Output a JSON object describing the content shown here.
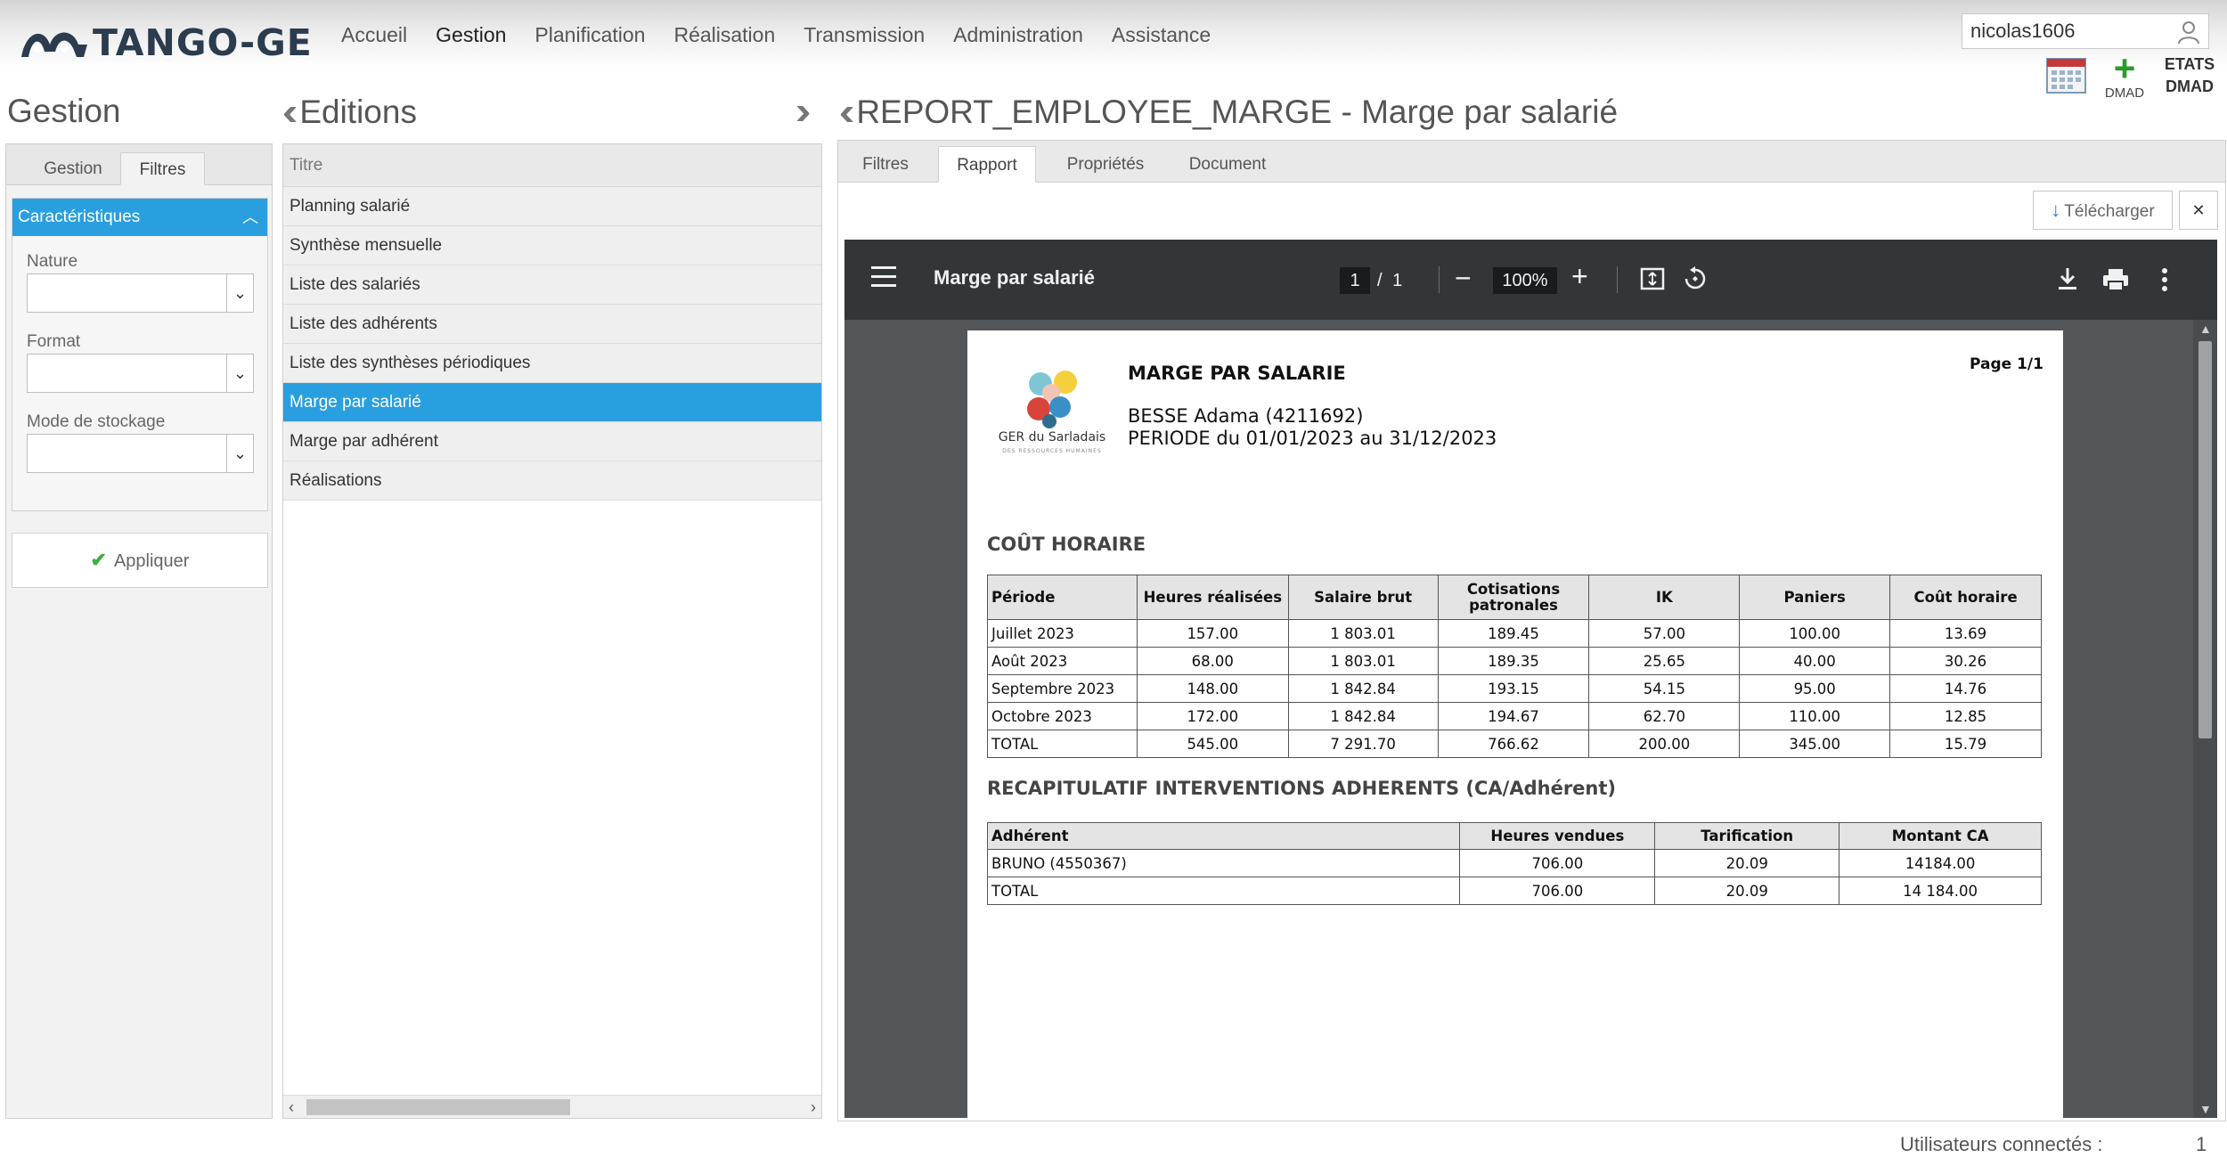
{
  "app": {
    "logo_text": "TANGO-GE",
    "nav": [
      "Accueil",
      "Gestion",
      "Planification",
      "Réalisation",
      "Transmission",
      "Administration",
      "Assistance"
    ],
    "user": "nicolas1606",
    "dmad_label": "DMAD",
    "etats_line1": "ETATS",
    "etats_line2": "DMAD"
  },
  "left": {
    "title": "Gestion",
    "tabs": [
      "Gestion",
      "Filtres"
    ],
    "section": "Caractéristiques",
    "fields": [
      "Nature",
      "Format",
      "Mode de stockage"
    ],
    "apply": "Appliquer"
  },
  "editions": {
    "title": "Editions",
    "header": "Titre",
    "items": [
      "Planning salarié",
      "Synthèse mensuelle",
      "Liste des salariés",
      "Liste des adhérents",
      "Liste des synthèses périodiques",
      "Marge par salarié",
      "Marge par adhérent",
      "Réalisations"
    ]
  },
  "report": {
    "title": "REPORT_EMPLOYEE_MARGE - Marge par salarié",
    "tabs": [
      "Filtres",
      "Rapport",
      "Propriétés",
      "Document"
    ],
    "download": "Télécharger",
    "viewer": {
      "doc_title": "Marge par salarié",
      "page": "1",
      "pages": "/ 1",
      "zoom": "100%"
    },
    "pdf": {
      "logo_label": "GER du Sarladais",
      "logo_sub": "DES RESSOURCES HUMAINES",
      "title": "MARGE PAR SALARIE",
      "page_label": "Page 1/1",
      "employee": "BESSE Adama (4211692)",
      "period": "PERIODE du 01/01/2023 au 31/12/2023",
      "section1": "COÛT HORAIRE",
      "cout_headers": [
        "Période",
        "Heures réalisées",
        "Salaire brut",
        "Cotisations patronales",
        "IK",
        "Paniers",
        "Coût horaire"
      ],
      "cout_rows": [
        [
          "Juillet 2023",
          "157.00",
          "1 803.01",
          "189.45",
          "57.00",
          "100.00",
          "13.69"
        ],
        [
          "Août 2023",
          "68.00",
          "1 803.01",
          "189.35",
          "25.65",
          "40.00",
          "30.26"
        ],
        [
          "Septembre 2023",
          "148.00",
          "1 842.84",
          "193.15",
          "54.15",
          "95.00",
          "14.76"
        ],
        [
          "Octobre 2023",
          "172.00",
          "1 842.84",
          "194.67",
          "62.70",
          "110.00",
          "12.85"
        ],
        [
          "TOTAL",
          "545.00",
          "7 291.70",
          "766.62",
          "200.00",
          "345.00",
          "15.79"
        ]
      ],
      "section2": "RECAPITULATIF INTERVENTIONS ADHERENTS (CA/Adhérent)",
      "recap_headers": [
        "Adhérent",
        "Heures vendues",
        "Tarification",
        "Montant CA"
      ],
      "recap_rows": [
        [
          "BRUNO (4550367)",
          "706.00",
          "20.09",
          "14184.00"
        ],
        [
          "TOTAL",
          "706.00",
          "20.09",
          "14 184.00"
        ]
      ]
    }
  },
  "footer": {
    "label": "Utilisateurs connectés :",
    "count": "1"
  }
}
